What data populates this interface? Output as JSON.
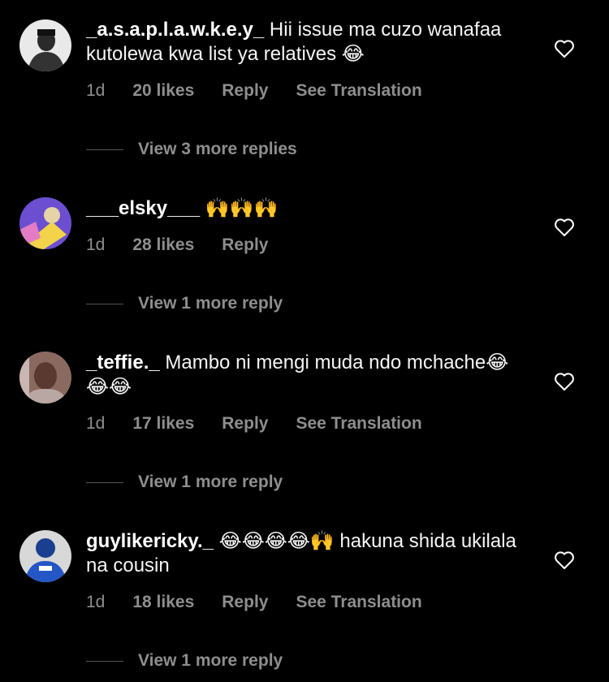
{
  "comments": [
    {
      "username": "_a.s.a.p.l.a.w.k.e.y_",
      "text": "Hii issue ma cuzo wanafaa kutolewa kwa list ya relatives 😂",
      "time": "1d",
      "likes": "20 likes",
      "reply": "Reply",
      "translate": "See Translation",
      "view_replies": "View 3 more replies"
    },
    {
      "username": "___elsky___",
      "text": "🙌🙌🙌",
      "time": "1d",
      "likes": "28 likes",
      "reply": "Reply",
      "view_replies": "View 1 more reply"
    },
    {
      "username": "_teffie._",
      "text": "Mambo ni mengi muda ndo mchache😂😂😂",
      "time": "1d",
      "likes": "17 likes",
      "reply": "Reply",
      "translate": "See Translation",
      "view_replies": "View 1 more reply"
    },
    {
      "username": "guylikericky._",
      "text": "😂😂😂😂🙌 hakuna shida ukilala na cousin",
      "time": "1d",
      "likes": "18 likes",
      "reply": "Reply",
      "translate": "See Translation",
      "view_replies": "View 1 more reply"
    }
  ],
  "icons": {
    "like": "heart-outline-icon"
  },
  "colors": {
    "background": "#000000",
    "text": "#f5f5f5",
    "meta": "#8e8e8e"
  }
}
